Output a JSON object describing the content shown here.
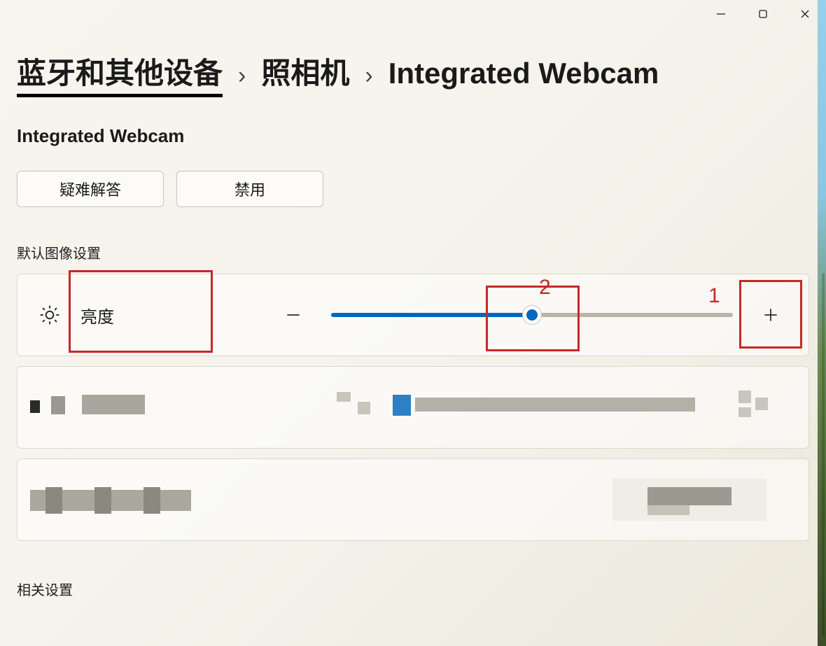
{
  "window": {
    "controls": {
      "minimize": "minimize",
      "maximize": "maximize",
      "close": "close"
    }
  },
  "breadcrumb": {
    "level1": "蓝牙和其他设备",
    "level2": "照相机",
    "current": "Integrated Webcam"
  },
  "subtitle": "Integrated Webcam",
  "actions": {
    "troubleshoot": "疑难解答",
    "disable": "禁用"
  },
  "sections": {
    "default_image": "默认图像设置",
    "related": "相关设置"
  },
  "brightness": {
    "label": "亮度",
    "percent": 50
  },
  "annotations": {
    "one": "1",
    "two": "2"
  },
  "colors": {
    "accent": "#0067c0",
    "annot": "#c62828"
  }
}
